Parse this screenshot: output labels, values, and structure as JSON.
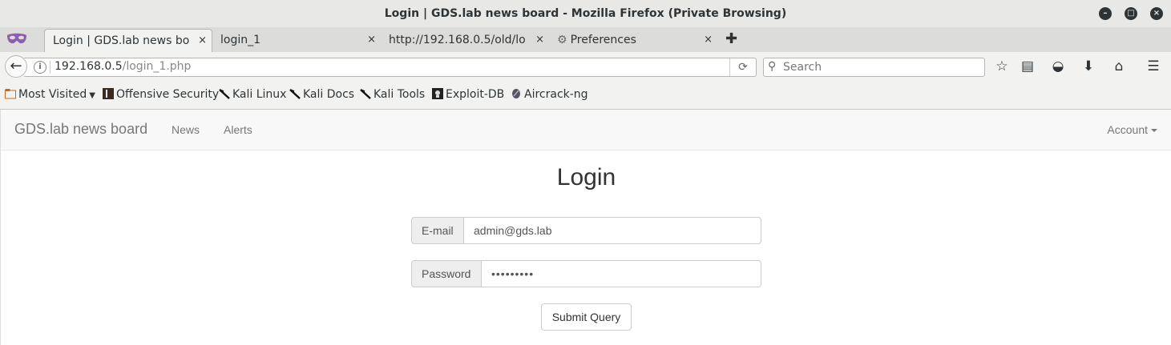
{
  "window": {
    "title": "Login | GDS.lab news board - Mozilla Firefox (Private Browsing)"
  },
  "tabs": [
    {
      "label": "Login | GDS.lab news bo...",
      "active": true
    },
    {
      "label": "login_1",
      "active": false
    },
    {
      "label": "http://192.168.0.5/old/lo...",
      "active": false
    },
    {
      "label": "Preferences",
      "active": false,
      "icon": "gear-icon"
    }
  ],
  "tab_close_glyph": "×",
  "new_tab_glyph": "✚",
  "navigation": {
    "url_host": "192.168.0.5",
    "url_path": "/login_1.php",
    "search_placeholder": "Search"
  },
  "bookmarks": [
    {
      "label": "Most Visited",
      "icon": "folder-icon",
      "dropdown": true
    },
    {
      "label": "Offensive Security",
      "icon": "offsec-icon"
    },
    {
      "label": "Kali Linux",
      "icon": "kali-icon"
    },
    {
      "label": "Kali Docs",
      "icon": "kali-icon"
    },
    {
      "label": "Kali Tools",
      "icon": "kali-icon"
    },
    {
      "label": "Exploit-DB",
      "icon": "exploitdb-icon"
    },
    {
      "label": "Aircrack-ng",
      "icon": "aircrack-icon"
    }
  ],
  "site": {
    "brand": "GDS.lab news board",
    "nav": [
      "News",
      "Alerts"
    ],
    "account": "Account",
    "heading": "Login",
    "email_label": "E-mail",
    "email_value": "admin@gds.lab",
    "password_label": "Password",
    "password_value": "•••••••••",
    "submit_label": "Submit Query"
  },
  "colors": {
    "chrome": "#f2f2f1",
    "private_mask": "#8d5daf",
    "navbar_bg": "#f8f8f8",
    "link_gray": "#777777"
  }
}
